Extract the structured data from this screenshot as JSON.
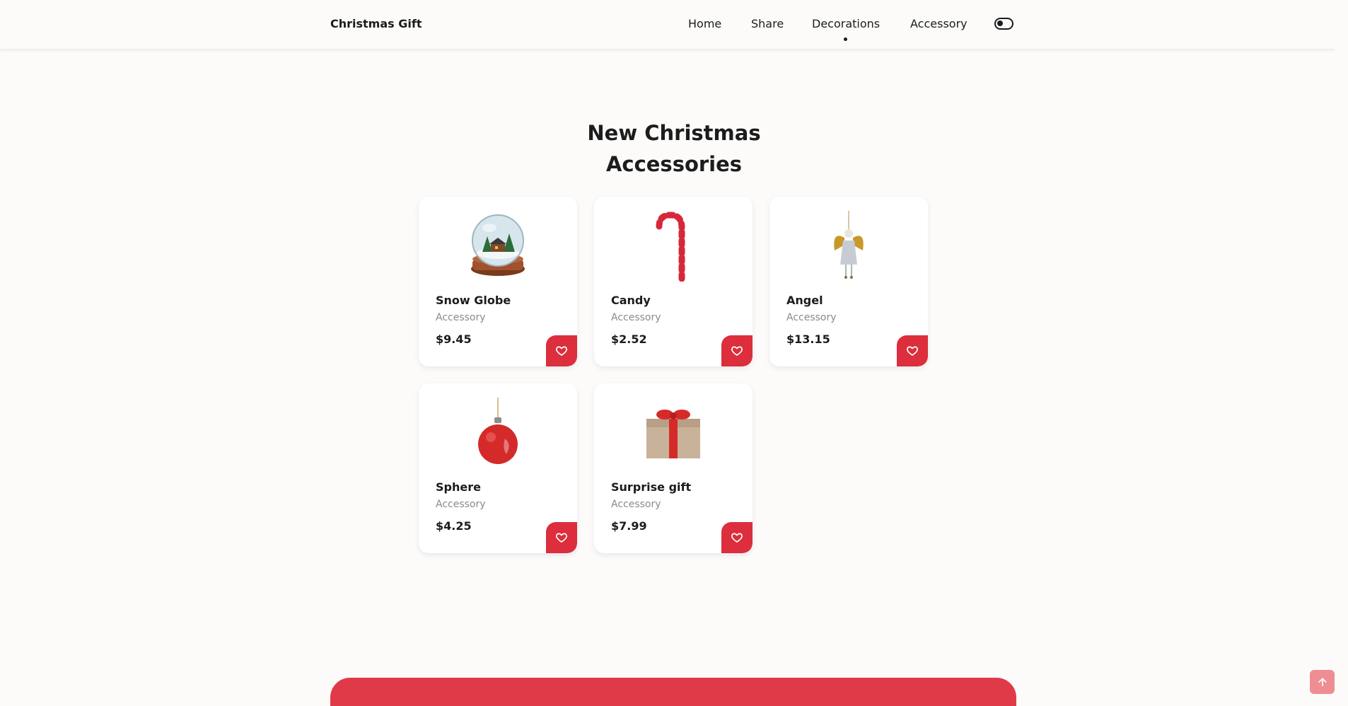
{
  "header": {
    "logo": "Christmas Gift",
    "nav": [
      {
        "label": "Home",
        "active": false
      },
      {
        "label": "Share",
        "active": false
      },
      {
        "label": "Decorations",
        "active": true
      },
      {
        "label": "Accessory",
        "active": false
      }
    ],
    "theme_toggle_icon": "toggle-icon"
  },
  "section": {
    "title_line1": "New Christmas",
    "title_line2": "Accessories"
  },
  "products": [
    {
      "name": "Snow Globe",
      "category": "Accessory",
      "price": "$9.45",
      "icon": "snow-globe"
    },
    {
      "name": "Candy",
      "category": "Accessory",
      "price": "$2.52",
      "icon": "candy-cane"
    },
    {
      "name": "Angel",
      "category": "Accessory",
      "price": "$13.15",
      "icon": "angel-ornament"
    },
    {
      "name": "Sphere",
      "category": "Accessory",
      "price": "$4.25",
      "icon": "red-bauble"
    },
    {
      "name": "Surprise gift",
      "category": "Accessory",
      "price": "$7.99",
      "icon": "gift-box"
    }
  ],
  "colors": {
    "accent": "#dc2e3c",
    "footer": "#e03a48",
    "scroll_button": "#ee8e93",
    "background": "#fcfbfa"
  }
}
